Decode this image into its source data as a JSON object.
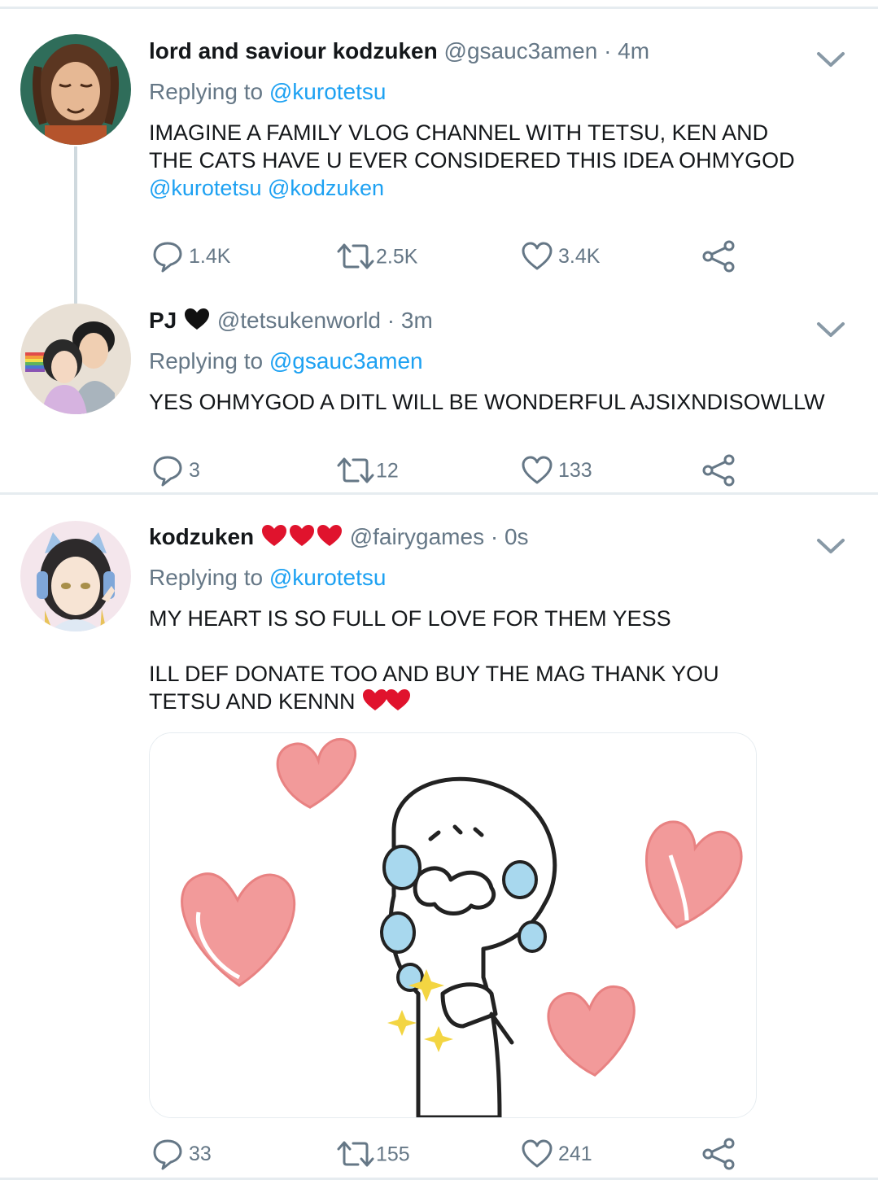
{
  "tweets": [
    {
      "display_name": "lord and saviour kodzuken",
      "handle": "@gsauc3amen",
      "time": "· 4m",
      "replying_prefix": "Replying to",
      "replying_to": "@kurotetsu",
      "text_lines": [
        "IMAGINE A FAMILY VLOG CHANNEL WITH TETSU, KEN AND",
        "THE CATS HAVE U EVER CONSIDERED THIS IDEA OHMYGOD"
      ],
      "mention_1": "@kurotetsu",
      "mention_2": "@kodzuken",
      "replies": "1.4K",
      "retweets": "2.5K",
      "likes": "3.4K"
    },
    {
      "display_name": "PJ",
      "handle": "@tetsukenworld",
      "time": "· 3m",
      "replying_prefix": "Replying to",
      "replying_to": "@gsauc3amen",
      "text": "YES OHMYGOD A DITL WILL BE WONDERFUL AJSIXNDISOWLLW",
      "replies": "3",
      "retweets": "12",
      "likes": "133"
    },
    {
      "display_name": "kodzuken",
      "handle": "@fairygames",
      "time": "· 0s",
      "replying_prefix": "Replying to",
      "replying_to": "@kurotetsu",
      "text_line_1": "MY HEART IS SO FULL OF LOVE FOR THEM YESS",
      "text_line_2": "ILL DEF DONATE TOO AND BUY THE MAG THANK YOU",
      "text_line_3": "TETSU AND KENNN",
      "replies": "33",
      "retweets": "155",
      "likes": "241"
    }
  ],
  "icons": [
    "reply-icon",
    "retweet-icon",
    "like-icon",
    "share-icon",
    "chevron-down-icon",
    "black-heart-emoji",
    "red-heart-emoji"
  ],
  "colors": {
    "link": "#1da1f2",
    "muted": "#657786",
    "text": "#14171a",
    "divider": "#e6ecf0",
    "heart_red": "#e0132d"
  }
}
